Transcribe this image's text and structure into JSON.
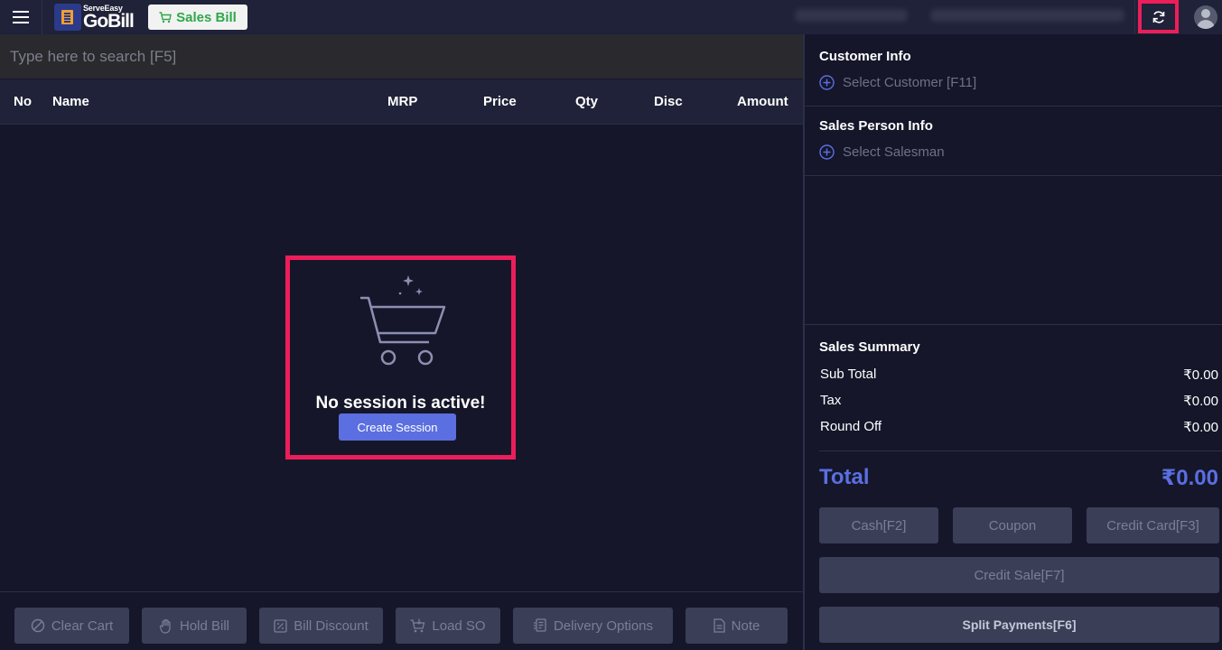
{
  "header": {
    "logo_small": "ServeEasy",
    "logo_big": "GoBill",
    "active_tab": "Sales Bill",
    "icons": [
      "menu-icon",
      "cart-icon",
      "refresh-icon",
      "user-avatar-icon"
    ]
  },
  "search": {
    "placeholder": "Type here to search [F5]"
  },
  "table": {
    "columns": [
      "No",
      "Name",
      "MRP",
      "Price",
      "Qty",
      "Disc",
      "Amount"
    ]
  },
  "empty_state": {
    "message": "No session is active!",
    "button": "Create Session",
    "icon": "empty-cart-icon"
  },
  "bottom_actions": [
    {
      "label": "Clear Cart",
      "icon": "ban-icon"
    },
    {
      "label": "Hold Bill",
      "icon": "hand-icon"
    },
    {
      "label": "Bill Discount",
      "icon": "percent-icon"
    },
    {
      "label": "Load SO",
      "icon": "cart-load-icon"
    },
    {
      "label": "Delivery Options",
      "icon": "delivery-icon"
    },
    {
      "label": "Note",
      "icon": "note-icon"
    }
  ],
  "customer": {
    "title": "Customer Info",
    "select_label": "Select Customer [F11]"
  },
  "salesperson": {
    "title": "Sales Person Info",
    "select_label": "Select Salesman"
  },
  "summary": {
    "title": "Sales Summary",
    "rows": [
      {
        "label": "Sub Total",
        "value": "₹0.00"
      },
      {
        "label": "Tax",
        "value": "₹0.00"
      },
      {
        "label": "Round Off",
        "value": "₹0.00"
      }
    ],
    "total_label": "Total",
    "total_value": "₹0.00"
  },
  "payments": {
    "cash": "Cash[F2]",
    "coupon": "Coupon",
    "credit_card": "Credit Card[F3]",
    "credit_sale": "Credit Sale[F7]",
    "split": "Split Payments[F6]"
  },
  "colors": {
    "accent": "#5b6fe0",
    "highlight": "#ec1e5a",
    "brand_green": "#2ea84a",
    "background": "#15162a"
  }
}
